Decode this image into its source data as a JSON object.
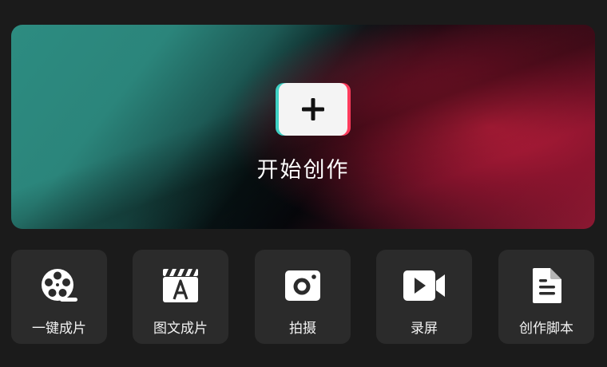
{
  "hero": {
    "label": "开始创作",
    "icon": "plus-icon"
  },
  "tools": [
    {
      "label": "一键成片",
      "icon": "film-reel-icon"
    },
    {
      "label": "图文成片",
      "icon": "clapper-text-icon"
    },
    {
      "label": "拍摄",
      "icon": "camera-icon"
    },
    {
      "label": "录屏",
      "icon": "video-camera-icon"
    },
    {
      "label": "创作脚本",
      "icon": "document-icon"
    }
  ],
  "colors": {
    "background": "#1b1b1b",
    "card": "#2b2b2b",
    "teal": "#2d8c81",
    "crimson": "#be1e3c",
    "text": "#ffffff"
  }
}
